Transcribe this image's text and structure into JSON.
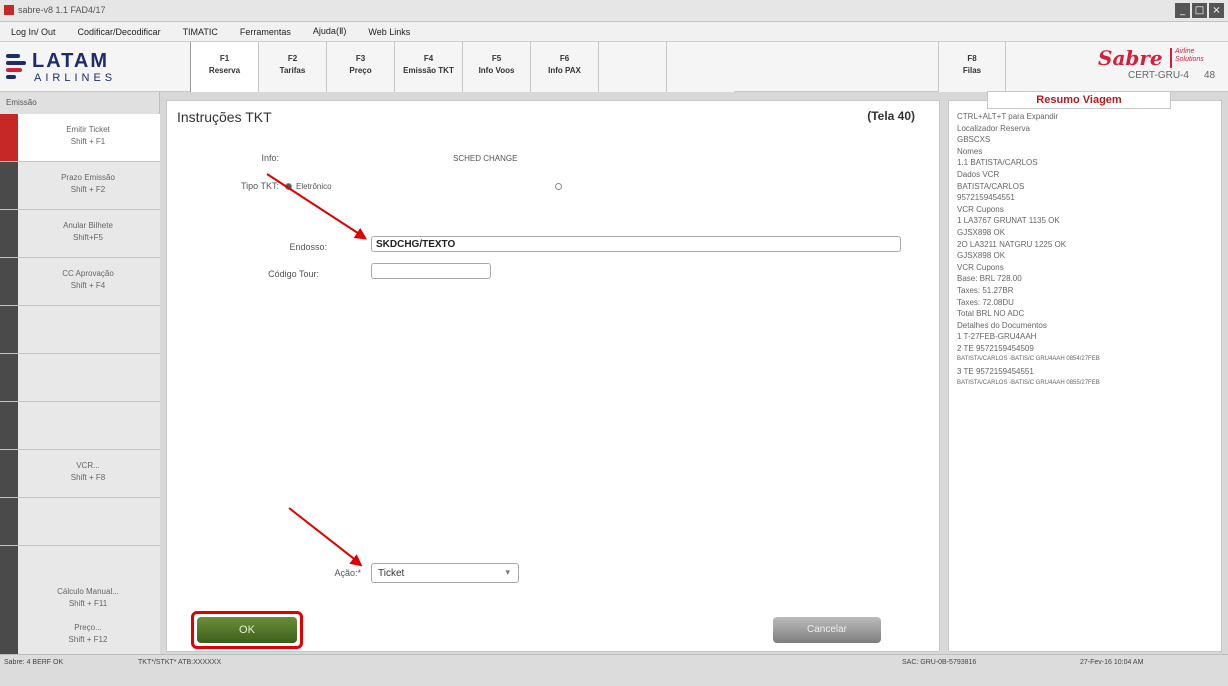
{
  "window": {
    "title": "sabre-v8 1.1 FAD4/17",
    "controls": [
      "_",
      "□",
      "×"
    ]
  },
  "menu": [
    "Log In/ Out",
    "Codificar/Decodificar",
    "TIMATIC",
    "Ferramentas",
    "Ajuda(Ⅱ)",
    "Web Links"
  ],
  "brand": {
    "name": "LATAM",
    "sub": "AIRLINES"
  },
  "fkeys": [
    {
      "key": "F1",
      "label": "Reserva"
    },
    {
      "key": "F2",
      "label": "Tarifas"
    },
    {
      "key": "F3",
      "label": "Preço"
    },
    {
      "key": "F4",
      "label": "Emissão TKT"
    },
    {
      "key": "F5",
      "label": "Info Voos"
    },
    {
      "key": "F6",
      "label": "Info PAX"
    }
  ],
  "filas": {
    "key": "F8",
    "label": "Filas"
  },
  "sabre": {
    "word": "Sabre",
    "solutions": "Airline Solutions",
    "cert": "CERT-GRU-4",
    "count": "48"
  },
  "leftnav": {
    "section": "Emissão",
    "items": [
      {
        "label": "Emitir Ticket",
        "shortcut": "Shift + F1"
      },
      {
        "label": "Prazo Emissão",
        "shortcut": "Shift + F2"
      },
      {
        "label": "Anular Bilhete",
        "shortcut": "Shift+F5"
      },
      {
        "label": "CC Aprovação",
        "shortcut": "Shift + F4"
      },
      {
        "label": "",
        "shortcut": ""
      },
      {
        "label": "",
        "shortcut": ""
      },
      {
        "label": "",
        "shortcut": ""
      },
      {
        "label": "VCR...",
        "shortcut": "Shift + F8"
      },
      {
        "label": "",
        "shortcut": ""
      },
      {
        "label": "",
        "shortcut": ""
      },
      {
        "label": "Cálculo Manual...",
        "shortcut": "Shift + F11"
      },
      {
        "label": "Preço...",
        "shortcut": "Shift + F12"
      }
    ]
  },
  "form": {
    "title": "Instruções TKT",
    "screen": "(Tela 40)",
    "info_label": "Info:",
    "info_value": "SCHED CHANGE",
    "tipo_label": "Tipo TKT:",
    "tipo_option": "Eletrônico",
    "endosso_label": "Endosso:",
    "endosso_value": "SKDCHG/TEXTO",
    "codigo_label": "Código Tour:",
    "codigo_value": "",
    "acao_label": "Ação:*",
    "acao_value": "Ticket",
    "ok": "OK",
    "cancel": "Cancelar"
  },
  "resumo": {
    "title": "Resumo Viagem",
    "lines": [
      "CTRL+ALT+T para Expandir",
      "Localizador Reserva",
      "GBSCXS",
      "Nomes",
      "1.1 BATISTA/CARLOS",
      "Dados VCR",
      "BATISTA/CARLOS",
      "9572159454551",
      "VCR Cupons",
      "1 LA3767  GRUNAT 1135 OK",
      "GJSX898 OK",
      "2O LA3211  NATGRU 1225 OK",
      "GJSX898 OK",
      "VCR Cupons",
      "Base: BRL  728.00",
      "Taxes:  51.27BR",
      "Taxes:  72.08DU",
      "Total BRL   NO ADC",
      "Detalhes do Documentos",
      "1 T-27FEB-GRU4AAH",
      "2 TE 9572159454509",
      "BATISTA/CARLOS  -BATIS/C GRU4AAH 0854/27FEB",
      "3 TE 9572159454551",
      "BATISTA/CARLOS  -BATIS/C GRU4AAH 0855/27FEB"
    ]
  },
  "status": {
    "left": "Sabre: 4 BERF OK",
    "mid": "TKT*/STKT* ATB:XXXXXX",
    "right1": "SAC: GRU-0B-5793816",
    "right2": "27-Fev-16 10:04 AM"
  }
}
